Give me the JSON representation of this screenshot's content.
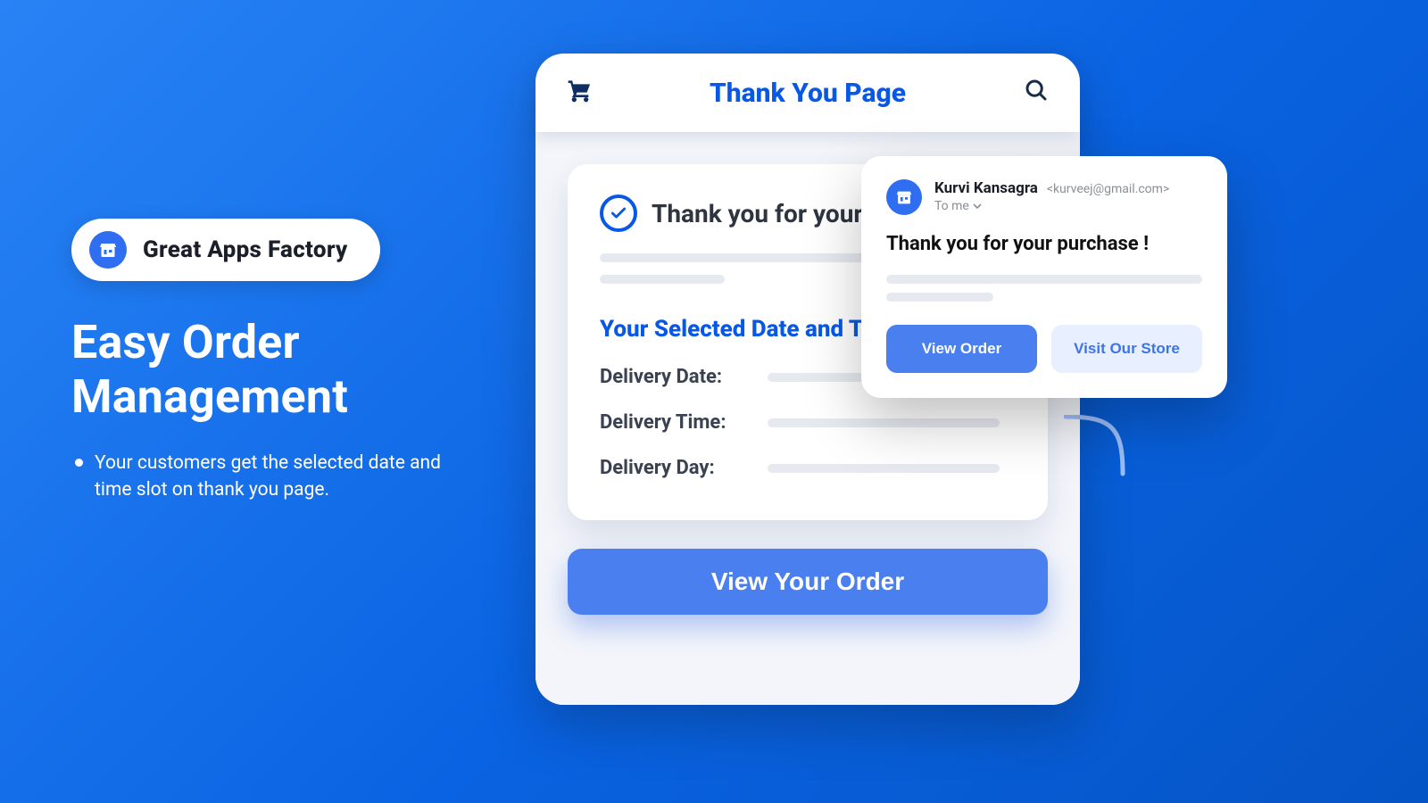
{
  "left": {
    "brand": "Great Apps Factory",
    "headline": "Easy Order Management",
    "bullet1": "Your customers get the selected date and time slot on thank you page."
  },
  "device": {
    "header_title": "Thank You Page",
    "thx": "Thank you for your purchase !",
    "section": "Your Selected Date and Time",
    "delivery_date_label": "Delivery Date:",
    "delivery_time_label": "Delivery Time:",
    "delivery_day_label": "Delivery Day:",
    "cta": "View Your Order"
  },
  "email": {
    "from_name": "Kurvi Kansagra",
    "from_email": "<kurveej@gmail.com>",
    "to_line": "To me",
    "subject": "Thank you for your purchase !",
    "view_order": "View Order",
    "visit_store": "Visit Our Store"
  }
}
